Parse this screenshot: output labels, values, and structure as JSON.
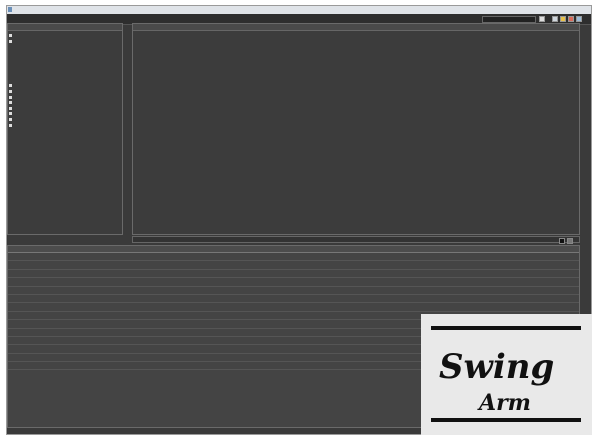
{
  "window": {
    "title": ""
  },
  "menu": {
    "items": [],
    "virtual_bench_label": ""
  },
  "library": {
    "title": "",
    "items": [
      {
        "text": ""
      },
      {
        "text": ""
      },
      {
        "text": ""
      },
      {
        "text": ""
      },
      {
        "text": ""
      },
      {
        "text": ""
      },
      {
        "text": ""
      },
      {
        "text": ""
      },
      {
        "text": ""
      },
      {
        "text": ""
      },
      {
        "text": ""
      },
      {
        "text": ""
      },
      {
        "text": ""
      },
      {
        "text": ""
      },
      {
        "text": ""
      },
      {
        "text": ""
      },
      {
        "text": ""
      },
      {
        "text": ""
      },
      {
        "text": ""
      },
      {
        "text": ""
      },
      {
        "text": ""
      },
      {
        "text": ""
      }
    ]
  },
  "sequence": {
    "columns": [
      "",
      "",
      ""
    ],
    "rows": [
      {
        "step": "",
        "inst": "",
        "params": ""
      },
      {
        "step": "",
        "inst": "",
        "params": ""
      },
      {
        "step": "",
        "inst": "",
        "params": ""
      },
      {
        "step": "",
        "inst": "",
        "params": ""
      },
      {
        "step": "",
        "inst": "",
        "params": ""
      },
      {
        "step": "",
        "inst": "",
        "params": ""
      },
      {
        "step": "",
        "inst": "",
        "params": ""
      },
      {
        "step": "",
        "inst": "",
        "params": ""
      },
      {
        "step": "",
        "inst": "",
        "params": ""
      },
      {
        "step": "",
        "inst": "",
        "params": ""
      },
      {
        "step": "",
        "inst": "",
        "params": ""
      },
      {
        "step": "",
        "inst": "",
        "params": ""
      },
      {
        "step": "",
        "inst": "",
        "params": ""
      },
      {
        "step": "",
        "inst": "",
        "params": ""
      },
      {
        "step": "",
        "inst": "",
        "params": ""
      },
      {
        "step": "",
        "inst": "",
        "params": ""
      },
      {
        "step": "",
        "inst": "",
        "params": ""
      },
      {
        "step": "",
        "inst": "",
        "params": ""
      },
      {
        "step": "",
        "inst": "",
        "params": ""
      }
    ]
  },
  "status": {
    "label": "",
    "results_table_label": ""
  },
  "results": {
    "columns": [
      "",
      "",
      "",
      "",
      ""
    ],
    "rows": [
      {
        "time": "",
        "inst": "",
        "step": "",
        "measurement": "",
        "value": ""
      },
      {
        "time": "",
        "inst": "",
        "step": "",
        "measurement": "",
        "value": ""
      },
      {
        "time": "",
        "inst": "",
        "step": "",
        "measurement": "",
        "value": ""
      },
      {
        "time": "",
        "inst": "",
        "step": "",
        "measurement": "",
        "value": ""
      },
      {
        "time": "",
        "inst": "",
        "step": "",
        "measurement": "",
        "value": ""
      },
      {
        "time": "",
        "inst": "",
        "step": "",
        "measurement": "",
        "value": ""
      },
      {
        "time": "",
        "inst": "",
        "step": "",
        "measurement": "",
        "value": ""
      },
      {
        "time": "",
        "inst": "",
        "step": "",
        "measurement": "",
        "value": ""
      },
      {
        "time": "",
        "inst": "",
        "step": "",
        "measurement": "",
        "value": ""
      },
      {
        "time": "",
        "inst": "",
        "step": "",
        "measurement": "",
        "value": ""
      },
      {
        "time": "",
        "inst": "",
        "step": "",
        "measurement": "",
        "value": ""
      },
      {
        "time": "",
        "inst": "",
        "step": "",
        "measurement": "",
        "value": ""
      },
      {
        "time": "",
        "inst": "",
        "step": "",
        "measurement": "",
        "value": ""
      },
      {
        "time": "",
        "inst": "",
        "step": "",
        "measurement": "",
        "value": ""
      }
    ]
  },
  "logo": {
    "line1": "Swing",
    "line2": "Arm"
  },
  "colors": {
    "highlight": "#4fb3ff",
    "panel": "#3c3c3c",
    "logo_bg": "#e9e9e9"
  }
}
